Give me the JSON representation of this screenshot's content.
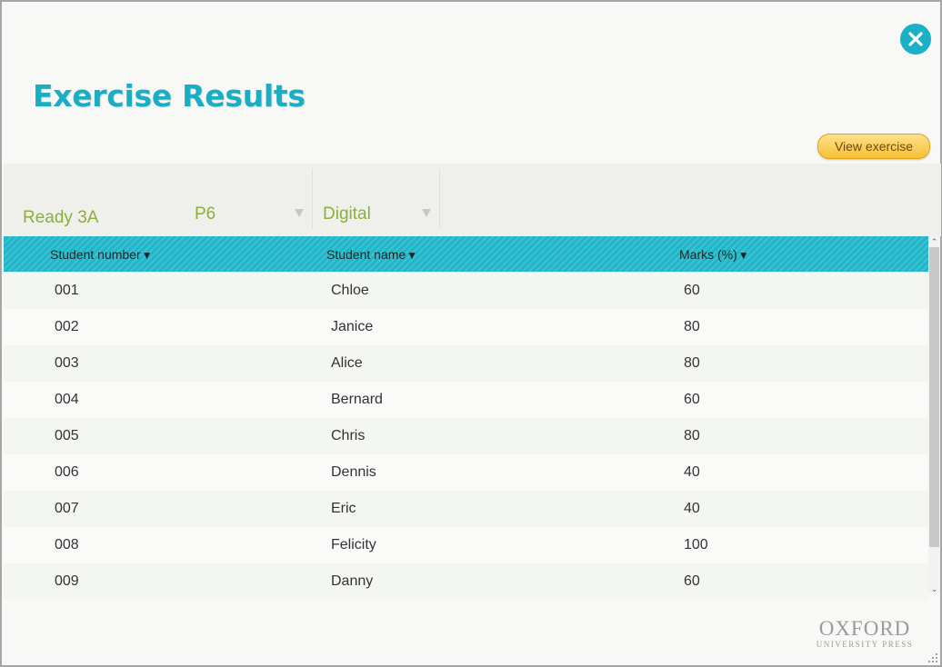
{
  "title": "Exercise Results",
  "close_icon": "close-icon",
  "view_button": "View exercise",
  "filters": {
    "class": "Ready 3A",
    "level": "P6",
    "type": "Digital"
  },
  "table": {
    "headers": {
      "number": "Student number",
      "name": "Student name",
      "marks": "Marks (%)",
      "sort_glyph": "▼"
    },
    "rows": [
      {
        "number": "001",
        "name": "Chloe",
        "marks": "60"
      },
      {
        "number": "002",
        "name": "Janice",
        "marks": "80"
      },
      {
        "number": "003",
        "name": "Alice",
        "marks": "80"
      },
      {
        "number": "004",
        "name": "Bernard",
        "marks": "60"
      },
      {
        "number": "005",
        "name": "Chris",
        "marks": "80"
      },
      {
        "number": "006",
        "name": "Dennis",
        "marks": "40"
      },
      {
        "number": "007",
        "name": "Eric",
        "marks": "40"
      },
      {
        "number": "008",
        "name": "Felicity",
        "marks": "100"
      },
      {
        "number": "009",
        "name": "Danny",
        "marks": "60"
      }
    ]
  },
  "logo": {
    "main": "OXFORD",
    "sub": "UNIVERSITY PRESS"
  },
  "colors": {
    "accent": "#1aaec4",
    "filter_text": "#8cae3d",
    "button": "#f7c136"
  }
}
